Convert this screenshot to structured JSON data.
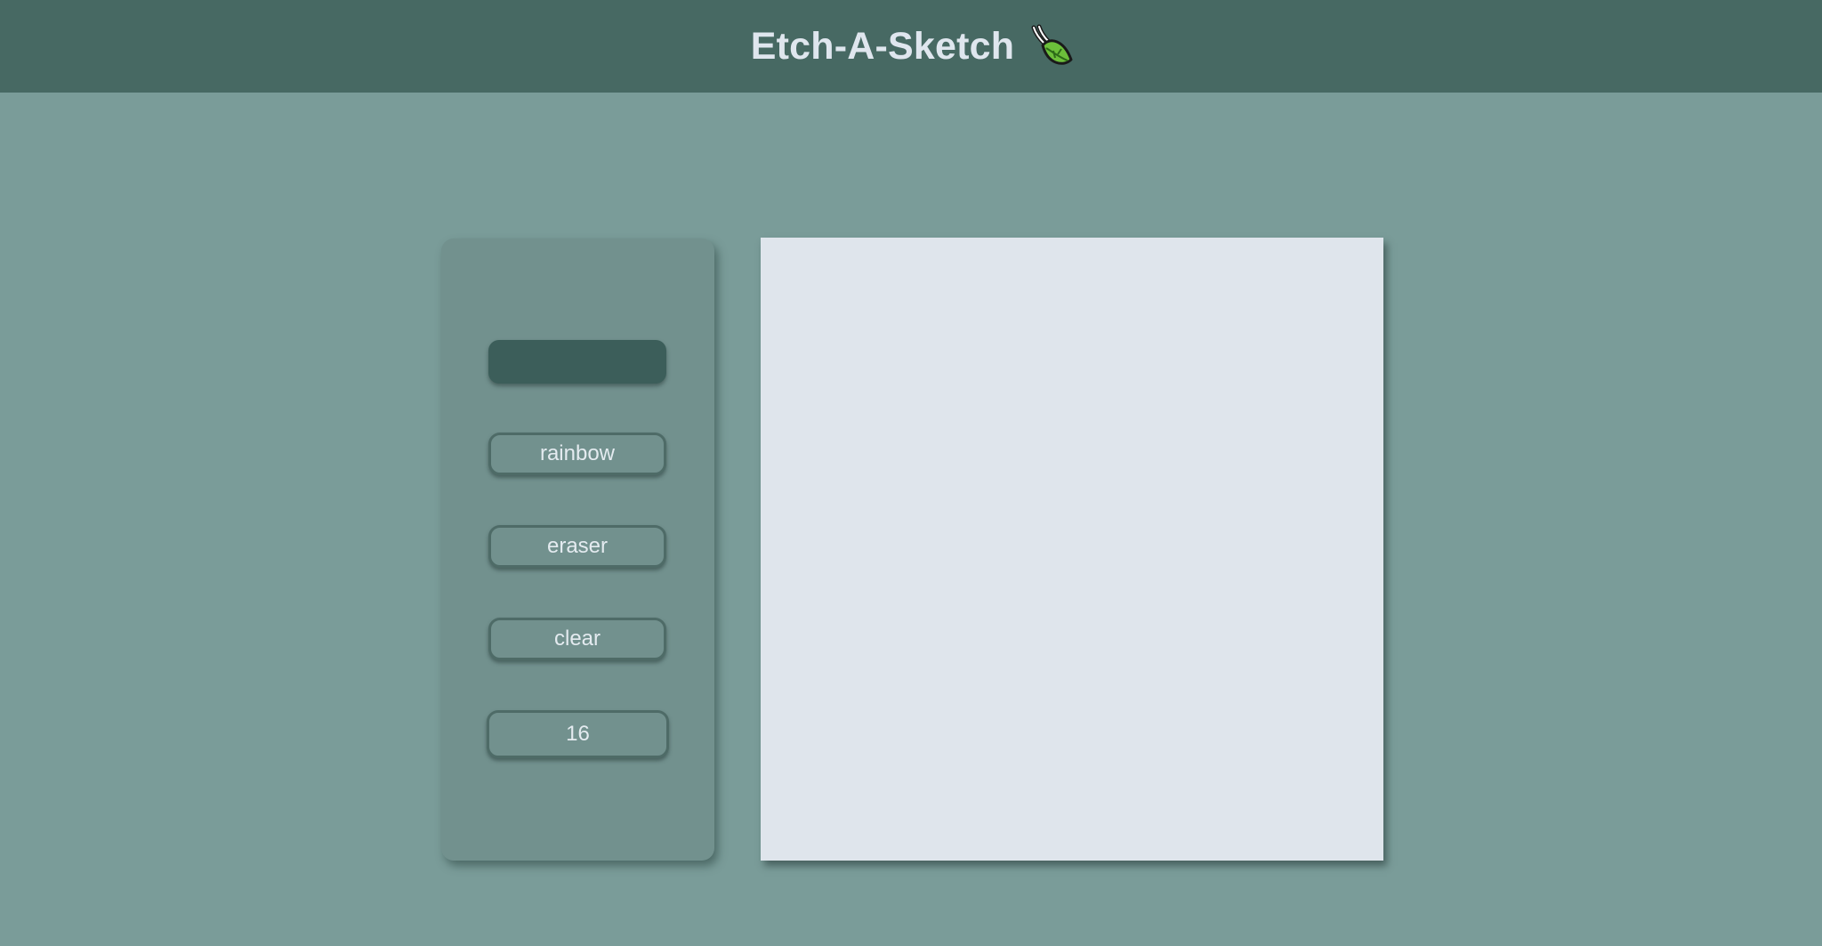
{
  "header": {
    "title": "Etch-A-Sketch",
    "icon": "leaf-icon",
    "background": "#476963"
  },
  "controls": {
    "color_picker_value": "#3c5e5a",
    "rainbow_label": "rainbow",
    "eraser_label": "eraser",
    "clear_label": "clear",
    "grid_size_value": "16"
  },
  "colors": {
    "page_background": "#7a9c99",
    "panel_background": "#72918e",
    "canvas_background": "#dfe5ec",
    "text": "#e4ebf0"
  }
}
